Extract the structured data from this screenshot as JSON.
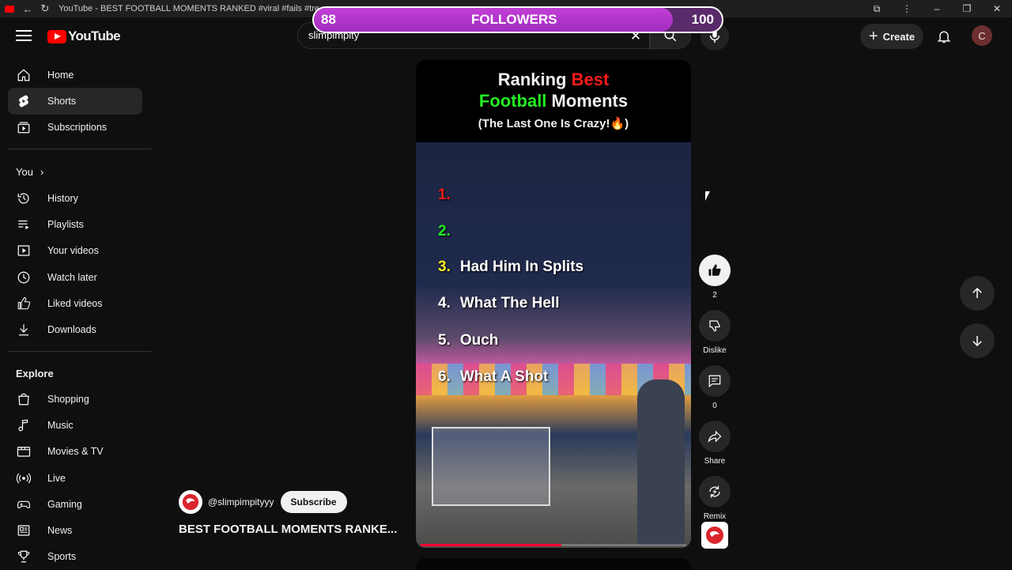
{
  "browser": {
    "tab_title": "YouTube - BEST FOOTBALL MOMENTS RANKED #viral #fails #trending #fu"
  },
  "overlay": {
    "current": "88",
    "label": "FOLLOWERS",
    "goal": "100",
    "progress": 0.88
  },
  "header": {
    "logo_text": "YouTube",
    "search_value": "slimpimpity",
    "create_label": "Create",
    "avatar_letter": "C"
  },
  "sidebar": {
    "main": [
      {
        "label": "Home",
        "icon": "home-icon"
      },
      {
        "label": "Shorts",
        "icon": "shorts-icon",
        "active": true
      },
      {
        "label": "Subscriptions",
        "icon": "subscriptions-icon"
      }
    ],
    "you_label": "You",
    "you_items": [
      {
        "label": "History",
        "icon": "history-icon"
      },
      {
        "label": "Playlists",
        "icon": "playlists-icon"
      },
      {
        "label": "Your videos",
        "icon": "your-videos-icon"
      },
      {
        "label": "Watch later",
        "icon": "watch-later-icon"
      },
      {
        "label": "Liked videos",
        "icon": "liked-videos-icon"
      },
      {
        "label": "Downloads",
        "icon": "downloads-icon"
      }
    ],
    "explore_label": "Explore",
    "explore_items": [
      {
        "label": "Shopping",
        "icon": "shopping-icon"
      },
      {
        "label": "Music",
        "icon": "music-icon"
      },
      {
        "label": "Movies & TV",
        "icon": "movies-icon"
      },
      {
        "label": "Live",
        "icon": "live-icon"
      },
      {
        "label": "Gaming",
        "icon": "gaming-icon"
      },
      {
        "label": "News",
        "icon": "news-icon"
      },
      {
        "label": "Sports",
        "icon": "sports-icon"
      }
    ]
  },
  "video": {
    "title_line1_a": "Ranking ",
    "title_line1_b": "Best",
    "title_line2_a": "Football",
    "title_line2_b": " Moments",
    "title_line3": "(The Last One Is Crazy!🔥)",
    "ranks": [
      {
        "num": "1.",
        "text": ""
      },
      {
        "num": "2.",
        "text": ""
      },
      {
        "num": "3.",
        "text": "Had Him In Splits"
      },
      {
        "num": "4.",
        "text": "What The Hell"
      },
      {
        "num": "5.",
        "text": "Ouch"
      },
      {
        "num": "6.",
        "text": "What A Shot"
      }
    ],
    "progress": 0.53
  },
  "actions": {
    "likes": "2",
    "dislike_label": "Dislike",
    "comments": "0",
    "share_label": "Share",
    "remix_label": "Remix"
  },
  "info": {
    "handle": "@slimpimpityyy",
    "subscribe_label": "Subscribe",
    "video_title": "BEST FOOTBALL MOMENTS RANKE..."
  }
}
